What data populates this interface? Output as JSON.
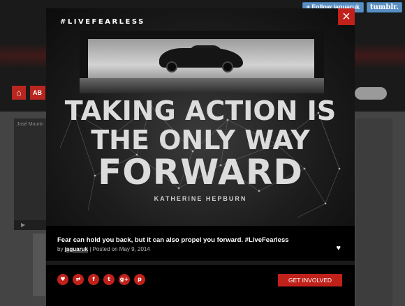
{
  "background": {
    "nav_first_label": "AB",
    "video_label": "José Mourin"
  },
  "tumblr_bar": {
    "follow_label": "+ Follow jaguaruk",
    "tumblr_label": "tumblr."
  },
  "post": {
    "close_glyph": "×",
    "hashtag": "#LIVEFEARLESS",
    "quote_lines": [
      "TAKING ACTION IS",
      "THE ONLY WAY",
      "FORWARD"
    ],
    "author": "KATHERINE HEPBURN",
    "caption": "Fear can hold you back, but it can also propel you forward. #LiveFearless",
    "meta_by": "by ",
    "meta_user": "jaguaruk",
    "meta_posted": " | Posted on May 9, 2014",
    "like_glyph": "♥"
  },
  "share": {
    "icons": [
      {
        "name": "heart-icon",
        "glyph": "♥"
      },
      {
        "name": "reblog-icon",
        "glyph": "⇄"
      },
      {
        "name": "facebook-icon",
        "glyph": "f"
      },
      {
        "name": "twitter-icon",
        "glyph": "t"
      },
      {
        "name": "google-plus-icon",
        "glyph": "g+"
      },
      {
        "name": "pinterest-icon",
        "glyph": "p"
      }
    ],
    "cta_label": "GET INVOLVED"
  },
  "colors": {
    "accent": "#c0211a",
    "tumblr_blue": "#5a8fc3"
  }
}
